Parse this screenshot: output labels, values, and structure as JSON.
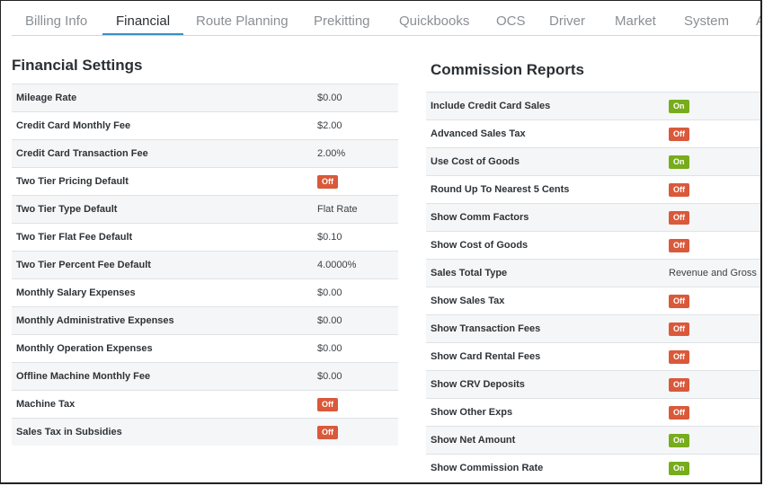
{
  "tabs": [
    {
      "label": "Billing Info"
    },
    {
      "label": "Financial"
    },
    {
      "label": "Route Planning"
    },
    {
      "label": "Prekitting"
    },
    {
      "label": "Quickbooks"
    },
    {
      "label": "OCS"
    },
    {
      "label": "Driver"
    },
    {
      "label": "Market"
    },
    {
      "label": "System"
    },
    {
      "label": "A"
    }
  ],
  "active_tab": "Financial",
  "financial": {
    "title": "Financial Settings",
    "rows": [
      {
        "label": "Mileage Rate",
        "value": "$0.00",
        "type": "text"
      },
      {
        "label": "Credit Card Monthly Fee",
        "value": "$2.00",
        "type": "text"
      },
      {
        "label": "Credit Card Transaction Fee",
        "value": "2.00%",
        "type": "text"
      },
      {
        "label": "Two Tier Pricing Default",
        "value": "Off",
        "type": "toggle"
      },
      {
        "label": "Two Tier Type Default",
        "value": "Flat Rate",
        "type": "text"
      },
      {
        "label": "Two Tier Flat Fee Default",
        "value": "$0.10",
        "type": "text"
      },
      {
        "label": "Two Tier Percent Fee Default",
        "value": "4.0000%",
        "type": "text"
      },
      {
        "label": "Monthly Salary Expenses",
        "value": "$0.00",
        "type": "text"
      },
      {
        "label": "Monthly Administrative Expenses",
        "value": "$0.00",
        "type": "text"
      },
      {
        "label": "Monthly Operation Expenses",
        "value": "$0.00",
        "type": "text"
      },
      {
        "label": "Offline Machine Monthly Fee",
        "value": "$0.00",
        "type": "text"
      },
      {
        "label": "Machine Tax",
        "value": "Off",
        "type": "toggle"
      },
      {
        "label": "Sales Tax in Subsidies",
        "value": "Off",
        "type": "toggle"
      }
    ]
  },
  "commission": {
    "title": "Commission Reports",
    "rows": [
      {
        "label": "Include Credit Card Sales",
        "value": "On",
        "type": "toggle"
      },
      {
        "label": "Advanced Sales Tax",
        "value": "Off",
        "type": "toggle"
      },
      {
        "label": "Use Cost of Goods",
        "value": "On",
        "type": "toggle"
      },
      {
        "label": "Round Up To Nearest 5 Cents",
        "value": "Off",
        "type": "toggle"
      },
      {
        "label": "Show Comm Factors",
        "value": "Off",
        "type": "toggle"
      },
      {
        "label": "Show Cost of Goods",
        "value": "Off",
        "type": "toggle"
      },
      {
        "label": "Sales Total Type",
        "value": "Revenue and Gross",
        "type": "text"
      },
      {
        "label": "Show Sales Tax",
        "value": "Off",
        "type": "toggle"
      },
      {
        "label": "Show Transaction Fees",
        "value": "Off",
        "type": "toggle"
      },
      {
        "label": "Show Card Rental Fees",
        "value": "Off",
        "type": "toggle"
      },
      {
        "label": "Show CRV Deposits",
        "value": "Off",
        "type": "toggle"
      },
      {
        "label": "Show Other Exps",
        "value": "Off",
        "type": "toggle"
      },
      {
        "label": "Show Net Amount",
        "value": "On",
        "type": "toggle"
      },
      {
        "label": "Show Commission Rate",
        "value": "On",
        "type": "toggle"
      }
    ]
  },
  "colors": {
    "on": "#77ac1c",
    "off": "#d9593a",
    "active_tab_underline": "#3a8fc5"
  }
}
